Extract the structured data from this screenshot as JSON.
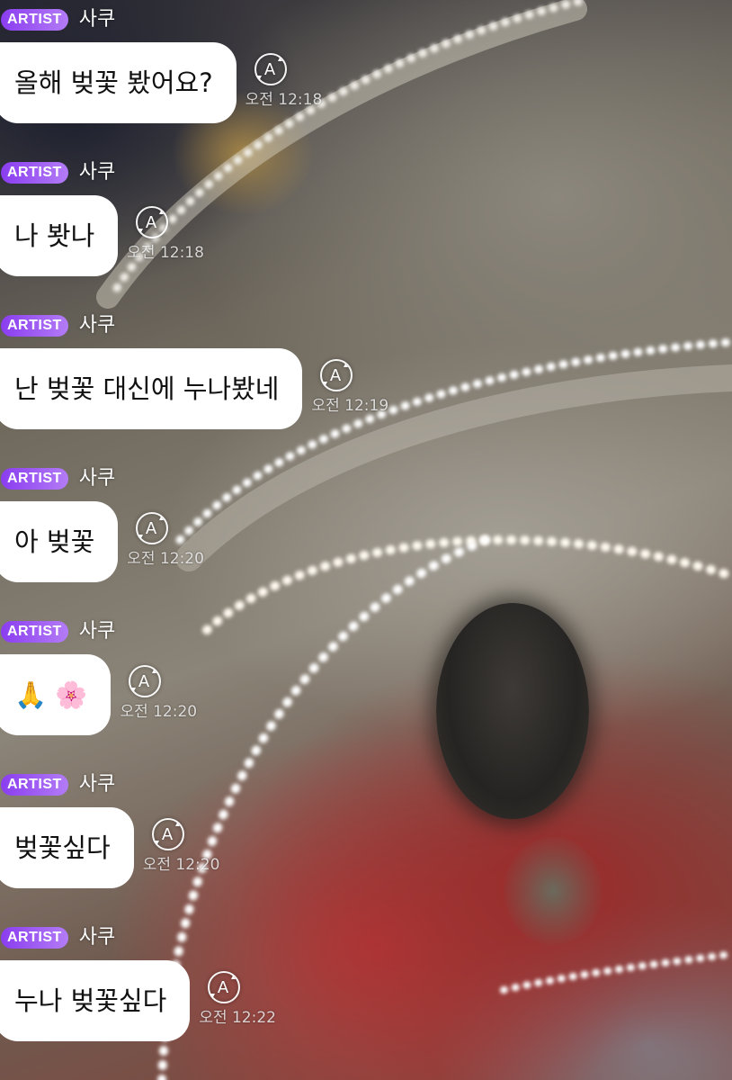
{
  "messages": [
    {
      "badge": "ARTIST",
      "sender": "사쿠",
      "text": "올해 벚꽃 봤어요?",
      "time": "오전 12:18"
    },
    {
      "badge": "ARTIST",
      "sender": "사쿠",
      "text": "나 봣나",
      "time": "오전 12:18"
    },
    {
      "badge": "ARTIST",
      "sender": "사쿠",
      "text": "난 벚꽃 대신에 누나봤네",
      "time": "오전 12:19"
    },
    {
      "badge": "ARTIST",
      "sender": "사쿠",
      "text": "아 벚꽃",
      "time": "오전 12:20"
    },
    {
      "badge": "ARTIST",
      "sender": "사쿠",
      "text": "🙏 🌸",
      "time": "오전 12:20"
    },
    {
      "badge": "ARTIST",
      "sender": "사쿠",
      "text": "벚꽃싶다",
      "time": "오전 12:20"
    },
    {
      "badge": "ARTIST",
      "sender": "사쿠",
      "text": "누나 벚꽃싶다",
      "time": "오전 12:22"
    }
  ],
  "colors": {
    "badge_start": "#8a3df0",
    "badge_end": "#b37cf6",
    "bubble": "#ffffff",
    "text": "#111111"
  },
  "icons": {
    "translate": "translate-icon"
  }
}
